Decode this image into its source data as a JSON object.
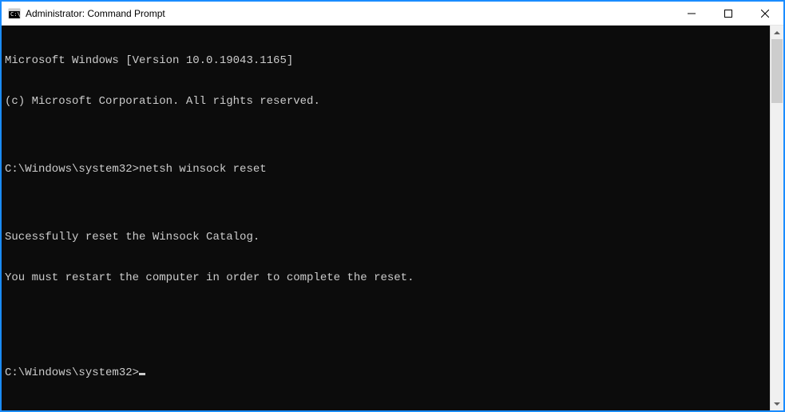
{
  "window": {
    "title": "Administrator: Command Prompt"
  },
  "terminal": {
    "lines": [
      "Microsoft Windows [Version 10.0.19043.1165]",
      "(c) Microsoft Corporation. All rights reserved.",
      "",
      "C:\\Windows\\system32>netsh winsock reset",
      "",
      "Sucessfully reset the Winsock Catalog.",
      "You must restart the computer in order to complete the reset.",
      "",
      ""
    ],
    "prompt": "C:\\Windows\\system32>"
  }
}
